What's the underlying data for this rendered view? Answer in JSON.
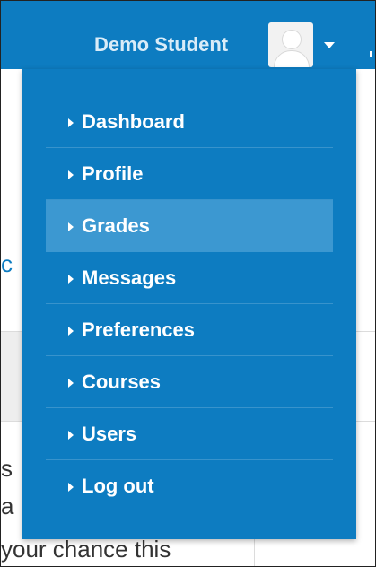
{
  "header": {
    "user_name": "Demo Student"
  },
  "icons": {
    "avatar": "user-avatar-icon",
    "caret": "caret-down-icon",
    "item_marker": "caret-right-icon"
  },
  "menu": {
    "items": [
      {
        "label": "Dashboard",
        "active": false
      },
      {
        "label": "Profile",
        "active": false
      },
      {
        "label": "Grades",
        "active": true
      },
      {
        "label": "Messages",
        "active": false
      },
      {
        "label": "Preferences",
        "active": false
      },
      {
        "label": "Courses",
        "active": false
      },
      {
        "label": "Users",
        "active": false
      },
      {
        "label": "Log out",
        "active": false
      }
    ]
  },
  "background": {
    "left_fragment_1": "c",
    "left_fragment_2": "s",
    "left_fragment_3": "a",
    "bottom_text": "your chance this"
  },
  "colors": {
    "brand": "#0d7cc1",
    "active_item": "#3c98d1",
    "text_light": "#ffffff"
  }
}
